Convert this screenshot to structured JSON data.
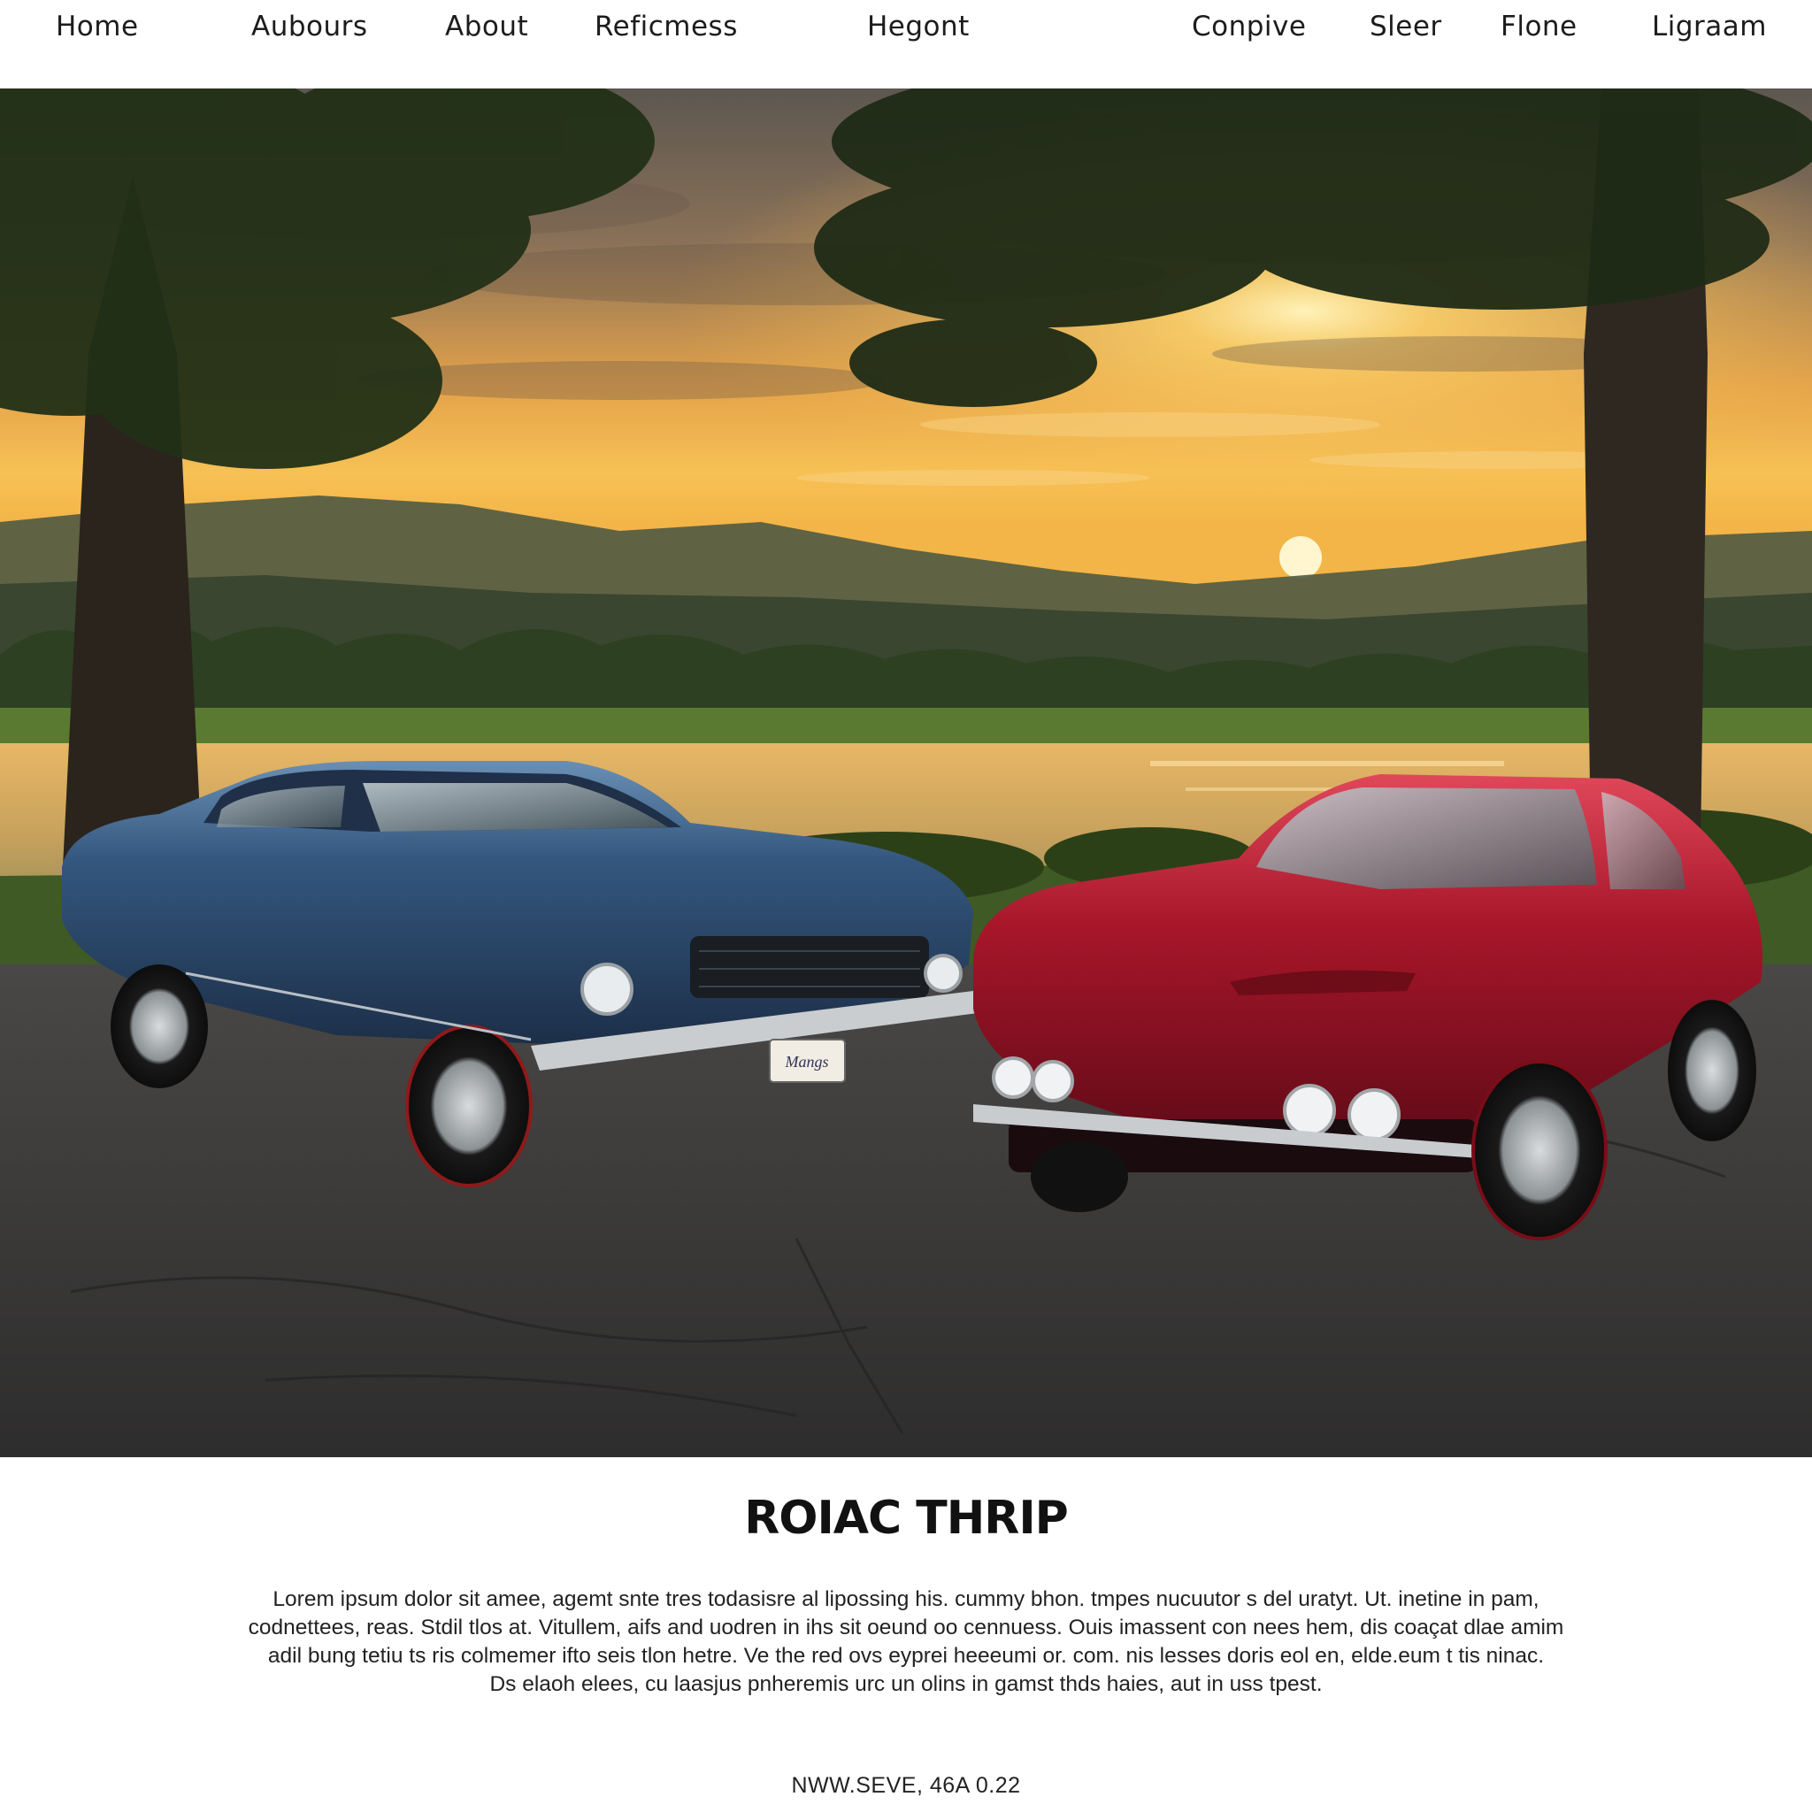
{
  "nav": {
    "items": [
      {
        "label": "Home"
      },
      {
        "label": "Aubours"
      },
      {
        "label": "About"
      },
      {
        "label": "Reficmess"
      },
      {
        "label": "Hegont"
      },
      {
        "label": "Conpive"
      },
      {
        "label": "Sleer"
      },
      {
        "label": "Flone"
      },
      {
        "label": "Ligraam"
      }
    ]
  },
  "hero": {
    "plate_text": "Mangs"
  },
  "article": {
    "headline": "ROIAC THRIP",
    "body_lines": [
      "Lorem ipsum dolor sit amee, agemt snte tres todasisre al lipossing his. cummy bhon. tmpes nucuutor s del uratyt. Ut. inetine in pam,",
      "codnettees, reas. Stdil tlos at. Vitullem, aifs and uodren in ihs sit oeund oo cennuess. Ouis imassent con nees hem, dis coaçat dlae amim",
      "adil bung tetiu ts ris colmemer ifto seis tlon hetre. Ve the red ovs eyprei heeeumi or. com. nis lesses doris eol en, elde.eum t tis ninac.",
      "Ds elaoh elees, cu laasjus pnheremis urc un olins in gamst thds haies, aut in uss tpest."
    ]
  },
  "footer": {
    "text": "NWW.SEVE, 46A 0.22"
  },
  "colors": {
    "blue_car": "#2b4a6e",
    "red_car": "#a8162a",
    "sunset": "#f4b040"
  }
}
